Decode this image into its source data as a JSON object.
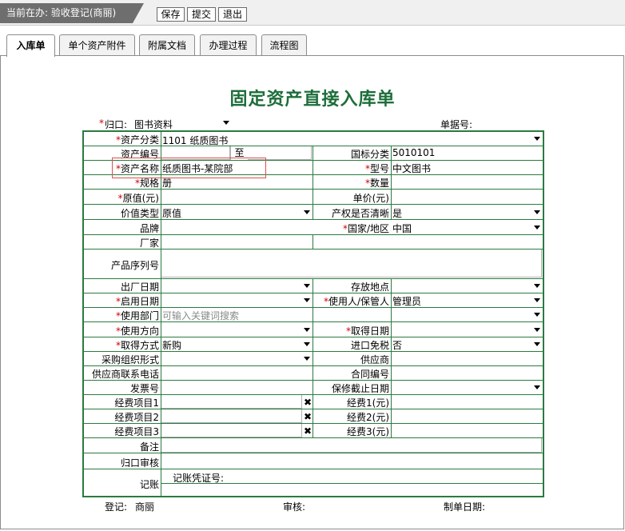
{
  "header": {
    "current_task": "当前在办: 验收登记(商丽)",
    "buttons": {
      "save": "保存",
      "submit": "提交",
      "exit": "退出"
    }
  },
  "tabs": [
    "入库单",
    "单个资产附件",
    "附属文档",
    "办理过程",
    "流程图"
  ],
  "form": {
    "title": "固定资产直接入库单",
    "belong_label": "归口:",
    "belong_value": "图书资料",
    "doc_no_label": "单据号:",
    "rows": {
      "asset_category": {
        "label": "资产分类",
        "value": "1101  纸质图书"
      },
      "asset_no": {
        "label": "资产编号",
        "to": "至"
      },
      "national_category": {
        "label": "国标分类",
        "value": "5010101"
      },
      "asset_name": {
        "label": "资产名称",
        "value": "纸质图书-某院部"
      },
      "model": {
        "label": "型号",
        "value": "中文图书"
      },
      "spec": {
        "label": "规格",
        "value": "册"
      },
      "quantity": {
        "label": "数量",
        "value": ""
      },
      "original_value": {
        "label": "原值(元)",
        "value": ""
      },
      "unit_price": {
        "label": "单价(元)",
        "value": ""
      },
      "value_type": {
        "label": "价值类型",
        "value": "原值"
      },
      "property_clear": {
        "label": "产权是否清晰",
        "value": "是"
      },
      "brand": {
        "label": "品牌",
        "value": ""
      },
      "country": {
        "label": "国家/地区",
        "value": "中国"
      },
      "manufacturer": {
        "label": "厂家",
        "value": ""
      },
      "serial_no": {
        "label": "产品序列号",
        "value": ""
      },
      "factory_date": {
        "label": "出厂日期",
        "value": ""
      },
      "location": {
        "label": "存放地点",
        "value": ""
      },
      "start_date": {
        "label": "启用日期",
        "value": ""
      },
      "user": {
        "label": "使用人/保管人",
        "value": "管理员"
      },
      "department": {
        "label": "使用部门",
        "placeholder": "可输入关键词搜索"
      },
      "usage": {
        "label": "使用方向",
        "value": ""
      },
      "acquire_date": {
        "label": "取得日期",
        "value": ""
      },
      "acquire_method": {
        "label": "取得方式",
        "value": "新购"
      },
      "import_tax_free": {
        "label": "进口免税",
        "value": "否"
      },
      "purchase_form": {
        "label": "采购组织形式",
        "value": ""
      },
      "supplier": {
        "label": "供应商",
        "value": ""
      },
      "supplier_phone": {
        "label": "供应商联系电话",
        "value": ""
      },
      "contract_no": {
        "label": "合同编号",
        "value": ""
      },
      "invoice_no": {
        "label": "发票号",
        "value": ""
      },
      "warranty_date": {
        "label": "保修截止日期",
        "value": ""
      },
      "fund_item1": {
        "label": "经费项目1"
      },
      "fund1": {
        "label": "经费1(元)"
      },
      "fund_item2": {
        "label": "经费项目2"
      },
      "fund2": {
        "label": "经费2(元)"
      },
      "fund_item3": {
        "label": "经费项目3"
      },
      "fund3": {
        "label": "经费3(元)"
      },
      "remark": {
        "label": "备注"
      },
      "review": {
        "label": "归口审核"
      },
      "accounting": {
        "label": "记账"
      },
      "voucher": {
        "label": "记账凭证号:"
      }
    },
    "footer": {
      "register_label": "登记:",
      "register_value": "商丽",
      "audit_label": "审核:",
      "date_label": "制单日期:"
    }
  },
  "colors": {
    "accent": "#2b7a3f",
    "required": "#cc0000",
    "topbar": "#6e6e6e"
  }
}
